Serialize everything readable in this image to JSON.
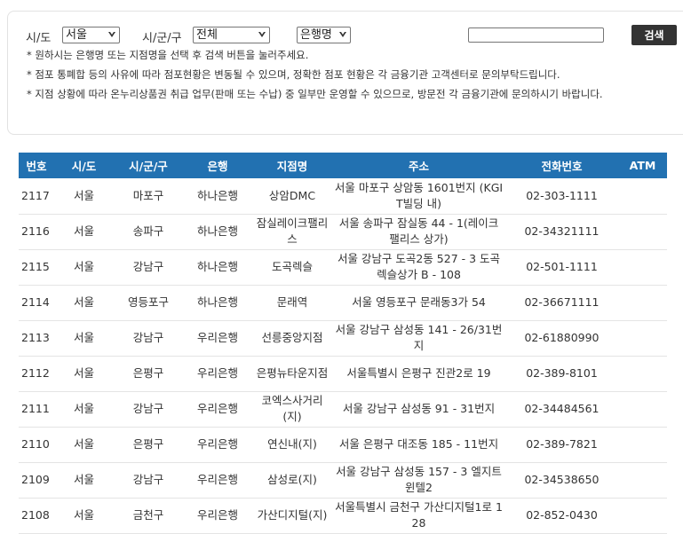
{
  "filter": {
    "sido_label": "시/도",
    "sido_value": "서울",
    "sigungu_label": "시/군/구",
    "sigungu_value": "전체",
    "bank_value": "은행명",
    "search_value": "",
    "search_button": "검색"
  },
  "notes": [
    "* 원하시는 은행명 또는 지점명을 선택 후 검색 버튼을 눌러주세요.",
    "* 점포 통폐합 등의 사유에 따라 점포현황은 변동될 수 있으며, 정확한 점포 현황은 각 금융기관 고객센터로 문의부탁드립니다.",
    "* 지점 상황에 따라 온누리상품권 취급 업무(판매 또는 수납) 중 일부만 운영할 수 있으므로, 방문전 각 금융기관에 문의하시기 바랍니다."
  ],
  "table": {
    "headers": [
      "번호",
      "시/도",
      "시/군/구",
      "은행",
      "지점명",
      "주소",
      "전화번호",
      "ATM"
    ],
    "rows": [
      {
        "no": "2117",
        "sido": "서울",
        "sigungu": "마포구",
        "bank": "하나은행",
        "branch": "상암DMC",
        "address": "서울 마포구 상암동 1601번지 (KGIT빌딩 내)",
        "phone": "02-303-1111",
        "atm": ""
      },
      {
        "no": "2116",
        "sido": "서울",
        "sigungu": "송파구",
        "bank": "하나은행",
        "branch": "잠실레이크팰리스",
        "address": "서울 송파구 잠실동 44 - 1(레이크팰리스 상가)",
        "phone": "02-34321111",
        "atm": ""
      },
      {
        "no": "2115",
        "sido": "서울",
        "sigungu": "강남구",
        "bank": "하나은행",
        "branch": "도곡렉슬",
        "address": "서울 강남구 도곡2동 527 - 3 도곡렉슬상가 B - 108",
        "phone": "02-501-1111",
        "atm": ""
      },
      {
        "no": "2114",
        "sido": "서울",
        "sigungu": "영등포구",
        "bank": "하나은행",
        "branch": "문래역",
        "address": "서울 영등포구 문래동3가 54",
        "phone": "02-36671111",
        "atm": ""
      },
      {
        "no": "2113",
        "sido": "서울",
        "sigungu": "강남구",
        "bank": "우리은행",
        "branch": "선릉중앙지점",
        "address": "서울 강남구 삼성동 141 - 26/31번지",
        "phone": "02-61880990",
        "atm": ""
      },
      {
        "no": "2112",
        "sido": "서울",
        "sigungu": "은평구",
        "bank": "우리은행",
        "branch": "은평뉴타운지점",
        "address": "서울특별시 은평구 진관2로 19",
        "phone": "02-389-8101",
        "atm": ""
      },
      {
        "no": "2111",
        "sido": "서울",
        "sigungu": "강남구",
        "bank": "우리은행",
        "branch": "코엑스사거리(지)",
        "address": "서울 강남구 삼성동 91 - 31번지",
        "phone": "02-34484561",
        "atm": ""
      },
      {
        "no": "2110",
        "sido": "서울",
        "sigungu": "은평구",
        "bank": "우리은행",
        "branch": "연신내(지)",
        "address": "서울 은평구 대조동 185 - 11번지",
        "phone": "02-389-7821",
        "atm": ""
      },
      {
        "no": "2109",
        "sido": "서울",
        "sigungu": "강남구",
        "bank": "우리은행",
        "branch": "삼성로(지)",
        "address": "서울 강남구 삼성동 157 - 3 엘지트윈텔2",
        "phone": "02-34538650",
        "atm": ""
      },
      {
        "no": "2108",
        "sido": "서울",
        "sigungu": "금천구",
        "bank": "우리은행",
        "branch": "가산디지털(지)",
        "address": "서울특별시 금천구 가산디지털1로 128",
        "phone": "02-852-0430",
        "atm": ""
      }
    ]
  }
}
